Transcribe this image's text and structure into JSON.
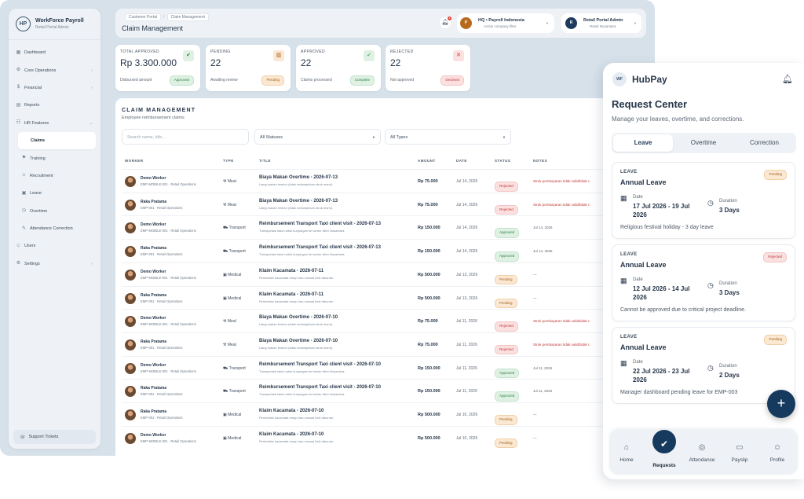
{
  "sidebar": {
    "app_name": "WorkForce Payroll",
    "app_sub": "Retail Portal Admin",
    "logo_text": "HP",
    "items": [
      {
        "label": "Dashboard",
        "icon": "dashboard-icon",
        "glyph": "▦",
        "chevron": false,
        "level": 0,
        "active": false
      },
      {
        "label": "Core Operations",
        "icon": "operations-icon",
        "glyph": "⚙",
        "chevron": true,
        "level": 0,
        "active": false
      },
      {
        "label": "Financial",
        "icon": "financial-icon",
        "glyph": "$",
        "chevron": true,
        "level": 0,
        "active": false
      },
      {
        "label": "Reports",
        "icon": "reports-icon",
        "glyph": "▤",
        "chevron": false,
        "level": 0,
        "active": false
      },
      {
        "label": "HR Features",
        "icon": "hr-icon",
        "glyph": "☷",
        "chevron": true,
        "chevron_open": true,
        "level": 0,
        "active": false
      },
      {
        "label": "Claims",
        "icon": "claims-icon",
        "glyph": "",
        "chevron": false,
        "level": 1,
        "active": true
      },
      {
        "label": "Training",
        "icon": "training-icon",
        "glyph": "⚑",
        "chevron": false,
        "level": 1,
        "active": false
      },
      {
        "label": "Recruitment",
        "icon": "recruitment-icon",
        "glyph": "☺",
        "chevron": false,
        "level": 1,
        "active": false
      },
      {
        "label": "Leave",
        "icon": "leave-icon",
        "glyph": "▣",
        "chevron": false,
        "level": 1,
        "active": false
      },
      {
        "label": "Overtime",
        "icon": "overtime-icon",
        "glyph": "◷",
        "chevron": false,
        "level": 1,
        "active": false
      },
      {
        "label": "Attendance Correction",
        "icon": "attendance-correction-icon",
        "glyph": "✎",
        "chevron": false,
        "level": 1,
        "active": false
      },
      {
        "label": "Users",
        "icon": "users-icon",
        "glyph": "☺",
        "chevron": false,
        "level": 0,
        "active": false
      },
      {
        "label": "Settings",
        "icon": "settings-icon",
        "glyph": "⚙",
        "chevron": true,
        "level": 0,
        "active": false
      }
    ],
    "support_label": "Support Tickets"
  },
  "topbar": {
    "breadcrumb": [
      "Customer Portal",
      "Claim Management"
    ],
    "page_title": "Claim Management",
    "notification_count": "1",
    "company_avatar": "P",
    "company_name": "HQ • Payroll Indonesia",
    "company_sub": "Active company filter",
    "user_avatar": "R",
    "user_name": "Retail Portal Admin",
    "user_sub": "Retail Nusantara"
  },
  "stats": [
    {
      "label": "TOTAL APPROVED",
      "value": "Rp 3.300.000",
      "sub": "Disbursed amount",
      "badge": "Approved",
      "badge_kind": "approved",
      "icon": "approved-check-icon",
      "glyph": "✔",
      "icon_bg": "#dff1e3",
      "icon_fg": "#2f8048"
    },
    {
      "label": "PENDING",
      "value": "22",
      "sub": "Awaiting review",
      "badge": "Pending",
      "badge_kind": "pending",
      "icon": "pending-clipboard-icon",
      "glyph": "▥",
      "icon_bg": "#fbe8d3",
      "icon_fg": "#a4601c"
    },
    {
      "label": "APPROVED",
      "value": "22",
      "sub": "Claims processed",
      "badge": "Complete",
      "badge_kind": "approved",
      "icon": "check-icon",
      "glyph": "✓",
      "icon_bg": "#dff1e3",
      "icon_fg": "#2f8048"
    },
    {
      "label": "REJECTED",
      "value": "22",
      "sub": "Not approved",
      "badge": "Declined",
      "badge_kind": "rejected",
      "icon": "reject-x-icon",
      "glyph": "✕",
      "icon_bg": "#fbe0e0",
      "icon_fg": "#c23a3a"
    }
  ],
  "claims": {
    "title": "CLAIM MANAGEMENT",
    "subtitle": "Employee reimbursement claims",
    "search_placeholder": "Search name, title...",
    "status_filter": "All Statuses",
    "type_filter": "All Types",
    "columns": [
      "WORKER",
      "TYPE",
      "TITLE",
      "AMOUNT",
      "DATE",
      "STATUS",
      "NOTES"
    ],
    "rows": [
      {
        "name": "Demo Worker",
        "id": "EMP-MOBILE-001 · Retail Operations",
        "type": "Meal",
        "type_icon": "meal-icon",
        "type_glyph": "⚒",
        "title": "Biaya Makan Overtime - 2026-07-13",
        "desc": "Uang makan lembur (tidak melampirkan struk resmi).",
        "amount": "Rp 75.000",
        "date": "Jul 14, 2026",
        "status": "Rejected",
        "status_kind": "rejected",
        "notes": "Struk pembayaran tidak valid/tidak c",
        "notes_red": true
      },
      {
        "name": "Raka Pratama",
        "id": "EMP-001 · Retail Operations",
        "type": "Meal",
        "type_icon": "meal-icon",
        "type_glyph": "⚒",
        "title": "Biaya Makan Overtime - 2026-07-13",
        "desc": "Uang makan lembur (tidak melampirkan struk resmi).",
        "amount": "Rp 75.000",
        "date": "Jul 14, 2026",
        "status": "Rejected",
        "status_kind": "rejected",
        "notes": "Struk pembayaran tidak valid/tidak c",
        "notes_red": true
      },
      {
        "name": "Demo Worker",
        "id": "EMP-MOBILE-001 · Retail Operations",
        "type": "Transport",
        "type_icon": "car-icon",
        "type_glyph": "⛟",
        "title": "Reimbursement Transport Taxi client visit - 2026-07-13",
        "desc": "Transportasi taksi untuk kunjungan ke kantor klien Nusantara.",
        "amount": "Rp 150.000",
        "date": "Jul 14, 2026",
        "status": "Approved",
        "status_kind": "approved",
        "notes": "Jul 14, 2026",
        "notes_red": false
      },
      {
        "name": "Raka Pratama",
        "id": "EMP-001 · Retail Operations",
        "type": "Transport",
        "type_icon": "car-icon",
        "type_glyph": "⛟",
        "title": "Reimbursement Transport Taxi client visit - 2026-07-13",
        "desc": "Transportasi taksi untuk kunjungan ke kantor klien Nusantara.",
        "amount": "Rp 150.000",
        "date": "Jul 14, 2026",
        "status": "Approved",
        "status_kind": "approved",
        "notes": "Jul 14, 2026",
        "notes_red": false
      },
      {
        "name": "Demo Worker",
        "id": "EMP-MOBILE-001 · Retail Operations",
        "type": "Medical",
        "type_icon": "medical-icon",
        "type_glyph": "▣",
        "title": "Klaim Kacamata - 2026-07-11",
        "desc": "Pembelian kacamata resep baru sesuai limit tahunan.",
        "amount": "Rp 500.000",
        "date": "Jul 13, 2026",
        "status": "Pending",
        "status_kind": "pending",
        "notes": "—",
        "notes_red": false
      },
      {
        "name": "Raka Pratama",
        "id": "EMP-001 · Retail Operations",
        "type": "Medical",
        "type_icon": "medical-icon",
        "type_glyph": "▣",
        "title": "Klaim Kacamata - 2026-07-11",
        "desc": "Pembelian kacamata resep baru sesuai limit tahunan.",
        "amount": "Rp 500.000",
        "date": "Jul 13, 2026",
        "status": "Pending",
        "status_kind": "pending",
        "notes": "—",
        "notes_red": false
      },
      {
        "name": "Demo Worker",
        "id": "EMP-MOBILE-001 · Retail Operations",
        "type": "Meal",
        "type_icon": "meal-icon",
        "type_glyph": "⚒",
        "title": "Biaya Makan Overtime - 2026-07-10",
        "desc": "Uang makan lembur (tidak melampirkan struk resmi).",
        "amount": "Rp 75.000",
        "date": "Jul 11, 2026",
        "status": "Rejected",
        "status_kind": "rejected",
        "notes": "Struk pembayaran tidak valid/tidak c",
        "notes_red": true
      },
      {
        "name": "Raka Pratama",
        "id": "EMP-001 · Retail Operations",
        "type": "Meal",
        "type_icon": "meal-icon",
        "type_glyph": "⚒",
        "title": "Biaya Makan Overtime - 2026-07-10",
        "desc": "Uang makan lembur (tidak melampirkan struk resmi).",
        "amount": "Rp 75.000",
        "date": "Jul 11, 2026",
        "status": "Rejected",
        "status_kind": "rejected",
        "notes": "Struk pembayaran tidak valid/tidak c",
        "notes_red": true
      },
      {
        "name": "Demo Worker",
        "id": "EMP-MOBILE-001 · Retail Operations",
        "type": "Transport",
        "type_icon": "car-icon",
        "type_glyph": "⛟",
        "title": "Reimbursement Transport Taxi client visit - 2026-07-10",
        "desc": "Transportasi taksi untuk kunjungan ke kantor klien Nusantara.",
        "amount": "Rp 150.000",
        "date": "Jul 11, 2026",
        "status": "Approved",
        "status_kind": "approved",
        "notes": "Jul 11, 2026",
        "notes_red": false
      },
      {
        "name": "Raka Pratama",
        "id": "EMP-001 · Retail Operations",
        "type": "Transport",
        "type_icon": "car-icon",
        "type_glyph": "⛟",
        "title": "Reimbursement Transport Taxi client visit - 2026-07-10",
        "desc": "Transportasi taksi untuk kunjungan ke kantor klien Nusantara.",
        "amount": "Rp 150.000",
        "date": "Jul 11, 2026",
        "status": "Approved",
        "status_kind": "approved",
        "notes": "Jul 11, 2026",
        "notes_red": false
      },
      {
        "name": "Raka Pratama",
        "id": "EMP-001 · Retail Operations",
        "type": "Medical",
        "type_icon": "medical-icon",
        "type_glyph": "▣",
        "title": "Klaim Kacamata - 2026-07-10",
        "desc": "Pembelian kacamata resep baru sesuai limit tahunan.",
        "amount": "Rp 500.000",
        "date": "Jul 10, 2026",
        "status": "Pending",
        "status_kind": "pending",
        "notes": "—",
        "notes_red": false
      },
      {
        "name": "Demo Worker",
        "id": "EMP-MOBILE-001 · Retail Operations",
        "type": "Medical",
        "type_icon": "medical-icon",
        "type_glyph": "▣",
        "title": "Klaim Kacamata - 2026-07-10",
        "desc": "Pembelian kacamata resep baru sesuai limit tahunan.",
        "amount": "Rp 500.000",
        "date": "Jul 10, 2026",
        "status": "Pending",
        "status_kind": "pending",
        "notes": "—",
        "notes_red": false
      }
    ]
  },
  "mobile": {
    "logo_text": "WF",
    "brand": "HubPay",
    "title": "Request Center",
    "subtitle": "Manage your leaves, overtime, and corrections.",
    "tabs": [
      {
        "label": "Leave",
        "active": true
      },
      {
        "label": "Overtime",
        "active": false
      },
      {
        "label": "Correction",
        "active": false
      }
    ],
    "cards": [
      {
        "kind": "LEAVE",
        "type": "Annual Leave",
        "status": "Pending",
        "status_kind": "pending",
        "date_label": "Date",
        "date": "17 Jul 2026 - 19 Jul 2026",
        "duration_label": "Duration",
        "duration": "3 Days",
        "note": "Religious festival holiday - 3 day leave"
      },
      {
        "kind": "LEAVE",
        "type": "Annual Leave",
        "status": "Rejected",
        "status_kind": "rejected",
        "date_label": "Date",
        "date": "12 Jul 2026 - 14 Jul 2026",
        "duration_label": "Duration",
        "duration": "3 Days",
        "note": "Cannot be approved due to critical project deadline."
      },
      {
        "kind": "LEAVE",
        "type": "Annual Leave",
        "status": "Pending",
        "status_kind": "pending",
        "date_label": "Date",
        "date": "22 Jul 2026 - 23 Jul 2026",
        "duration_label": "Duration",
        "duration": "2 Days",
        "note": "Manager dashboard pending leave for EMP-003"
      }
    ],
    "fab_label": "+",
    "bottom_nav": [
      {
        "label": "Home",
        "icon": "home-icon",
        "glyph": "⌂",
        "active": false
      },
      {
        "label": "Requests",
        "icon": "requests-icon",
        "glyph": "✔",
        "active": true
      },
      {
        "label": "Attendance",
        "icon": "fingerprint-icon",
        "glyph": "◎",
        "active": false
      },
      {
        "label": "Payslip",
        "icon": "payslip-icon",
        "glyph": "▭",
        "active": false
      },
      {
        "label": "Profile",
        "icon": "profile-icon",
        "glyph": "☺",
        "active": false
      }
    ]
  }
}
